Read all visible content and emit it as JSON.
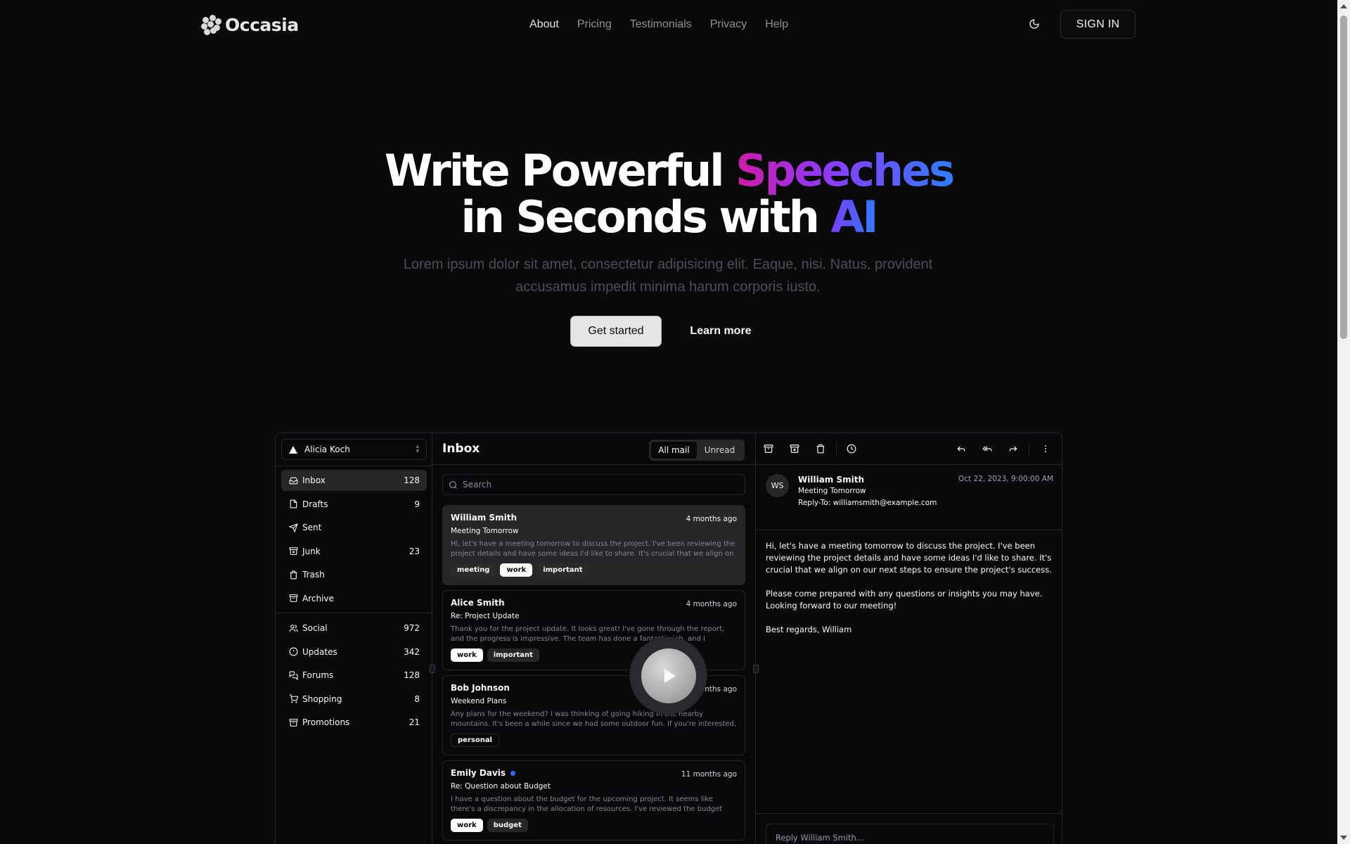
{
  "brand": {
    "name": "Occasia"
  },
  "nav": {
    "links": [
      "About",
      "Pricing",
      "Testimonials",
      "Privacy",
      "Help"
    ],
    "active": "About",
    "signin": "SIGN IN"
  },
  "hero": {
    "title_part1": "Write Powerful ",
    "title_highlight1": "Speeches",
    "title_part2": "in Seconds with ",
    "title_highlight2": "AI",
    "subtitle": "Lorem ipsum dolor sit amet, consectetur adipisicing elit. Eaque, nisi. Natus, provident accusamus impedit minima harum corporis iusto.",
    "primary_cta": "Get started",
    "secondary_cta": "Learn more"
  },
  "mail": {
    "account": "Alicia Koch",
    "folders": [
      {
        "label": "Inbox",
        "count": "128",
        "icon": "inbox-icon"
      },
      {
        "label": "Drafts",
        "count": "9",
        "icon": "file-icon"
      },
      {
        "label": "Sent",
        "count": "",
        "icon": "send-icon"
      },
      {
        "label": "Junk",
        "count": "23",
        "icon": "archive-x-icon"
      },
      {
        "label": "Trash",
        "count": "",
        "icon": "trash-icon"
      },
      {
        "label": "Archive",
        "count": "",
        "icon": "archive-icon"
      }
    ],
    "categories": [
      {
        "label": "Social",
        "count": "972",
        "icon": "users-icon"
      },
      {
        "label": "Updates",
        "count": "342",
        "icon": "alert-circle-icon"
      },
      {
        "label": "Forums",
        "count": "128",
        "icon": "messages-icon"
      },
      {
        "label": "Shopping",
        "count": "8",
        "icon": "cart-icon"
      },
      {
        "label": "Promotions",
        "count": "21",
        "icon": "archive-icon"
      }
    ],
    "list_title": "Inbox",
    "filter_all": "All mail",
    "filter_unread": "Unread",
    "search_placeholder": "Search",
    "messages": [
      {
        "from": "William Smith",
        "when": "4 months ago",
        "subject": "Meeting Tomorrow",
        "body": "Hi, let's have a meeting tomorrow to discuss the project. I've been reviewing the project details and have some ideas I'd like to share. It's crucial that we align on our next step...",
        "tags": [
          "meeting",
          "work",
          "important"
        ],
        "unread": false
      },
      {
        "from": "Alice Smith",
        "when": "4 months ago",
        "subject": "Re: Project Update",
        "body": "Thank you for the project update. It looks great! I've gone through the report, and the progress is impressive. The team has done a fantastic job, and I appreciate the hard...",
        "tags": [
          "work",
          "important"
        ],
        "unread": false
      },
      {
        "from": "Bob Johnson",
        "when": "4 months ago",
        "subject": "Weekend Plans",
        "body": "Any plans for the weekend? I was thinking of going hiking in the nearby mountains. It's been a while since we had some outdoor fun. If you're interested, let me know, and we...",
        "tags": [
          "personal"
        ],
        "unread": false
      },
      {
        "from": "Emily Davis",
        "when": "11 months ago",
        "subject": "Re: Question about Budget",
        "body": "I have a question about the budget for the upcoming project. It seems like there's a discrepancy in the allocation of resources. I've reviewed the budget report and...",
        "tags": [
          "work",
          "budget"
        ],
        "unread": true
      }
    ],
    "reader": {
      "initials": "WS",
      "name": "William Smith",
      "subject": "Meeting Tomorrow",
      "reply_to": "Reply-To: williamsmith@example.com",
      "date": "Oct 22, 2023, 9:00:00 AM",
      "paragraph1": "Hi, let's have a meeting tomorrow to discuss the project. I've been reviewing the project details and have some ideas I'd like to share. It's crucial that we align on our next steps to ensure the project's success.",
      "paragraph2_line1": "Please come prepared with any questions or insights you may have.",
      "paragraph2_line2": "Looking forward to our meeting!",
      "signoff": "Best regards, William",
      "reply_placeholder": "Reply William Smith..."
    }
  },
  "colors": {
    "background": "#0a0a0b",
    "accent_pink": "#d11aa8",
    "accent_blue": "#2e7dff",
    "unread_dot": "#2f6bff"
  }
}
